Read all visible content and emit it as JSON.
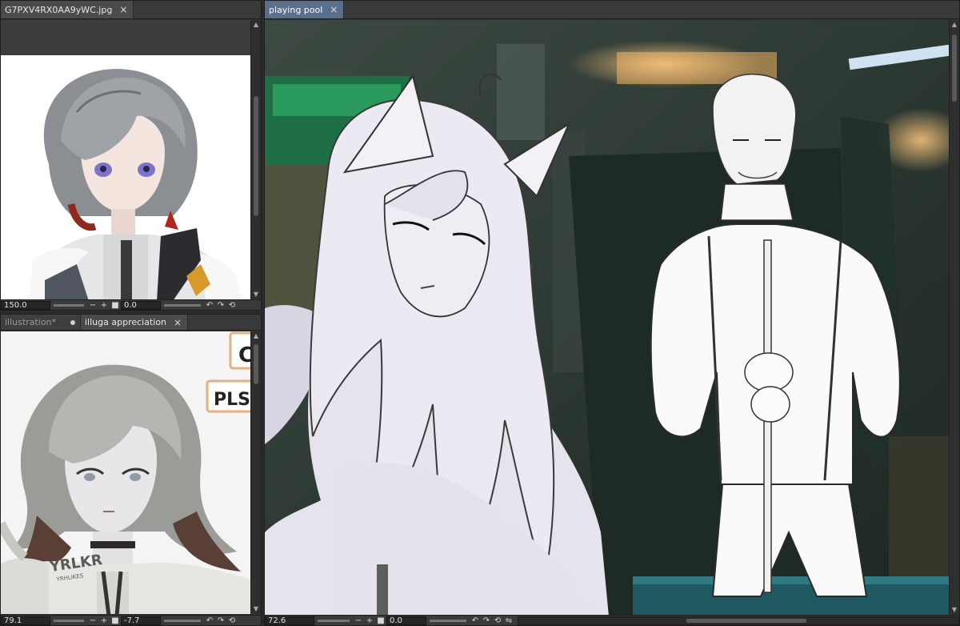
{
  "panes": {
    "top_left": {
      "tab": {
        "label": "G7PXV4RX0AA9yWC.jpg",
        "close": "×"
      },
      "status": {
        "zoom": "150.0",
        "minus": "−",
        "plus": "+",
        "rotation": "0.0"
      }
    },
    "bottom_left": {
      "tabs": [
        {
          "label": "illustration*"
        },
        {
          "label": "illuga appreciation",
          "close": "×"
        }
      ],
      "canvas_text": {
        "bubble1": "C",
        "bubble2": "PLS",
        "watermark": "YRLKR",
        "watermark_sub": "YRHLIKES"
      },
      "status": {
        "zoom": "79.1",
        "minus": "−",
        "plus": "+",
        "rotation": "-7.7"
      }
    },
    "right": {
      "tab": {
        "label": "playing pool",
        "close": "×"
      },
      "status": {
        "zoom": "72.6",
        "minus": "−",
        "plus": "+",
        "rotation": "0.0"
      }
    }
  },
  "icons": [
    "close-icon",
    "modified-dot-icon",
    "undo-rotate-icon",
    "redo-rotate-icon",
    "reset-rotate-icon",
    "scroll-up-arrow-icon",
    "scroll-down-arrow-icon"
  ],
  "colors": {
    "active_tab": "#5a6f8c",
    "panel": "#3a3a3a",
    "field": "#262626"
  }
}
